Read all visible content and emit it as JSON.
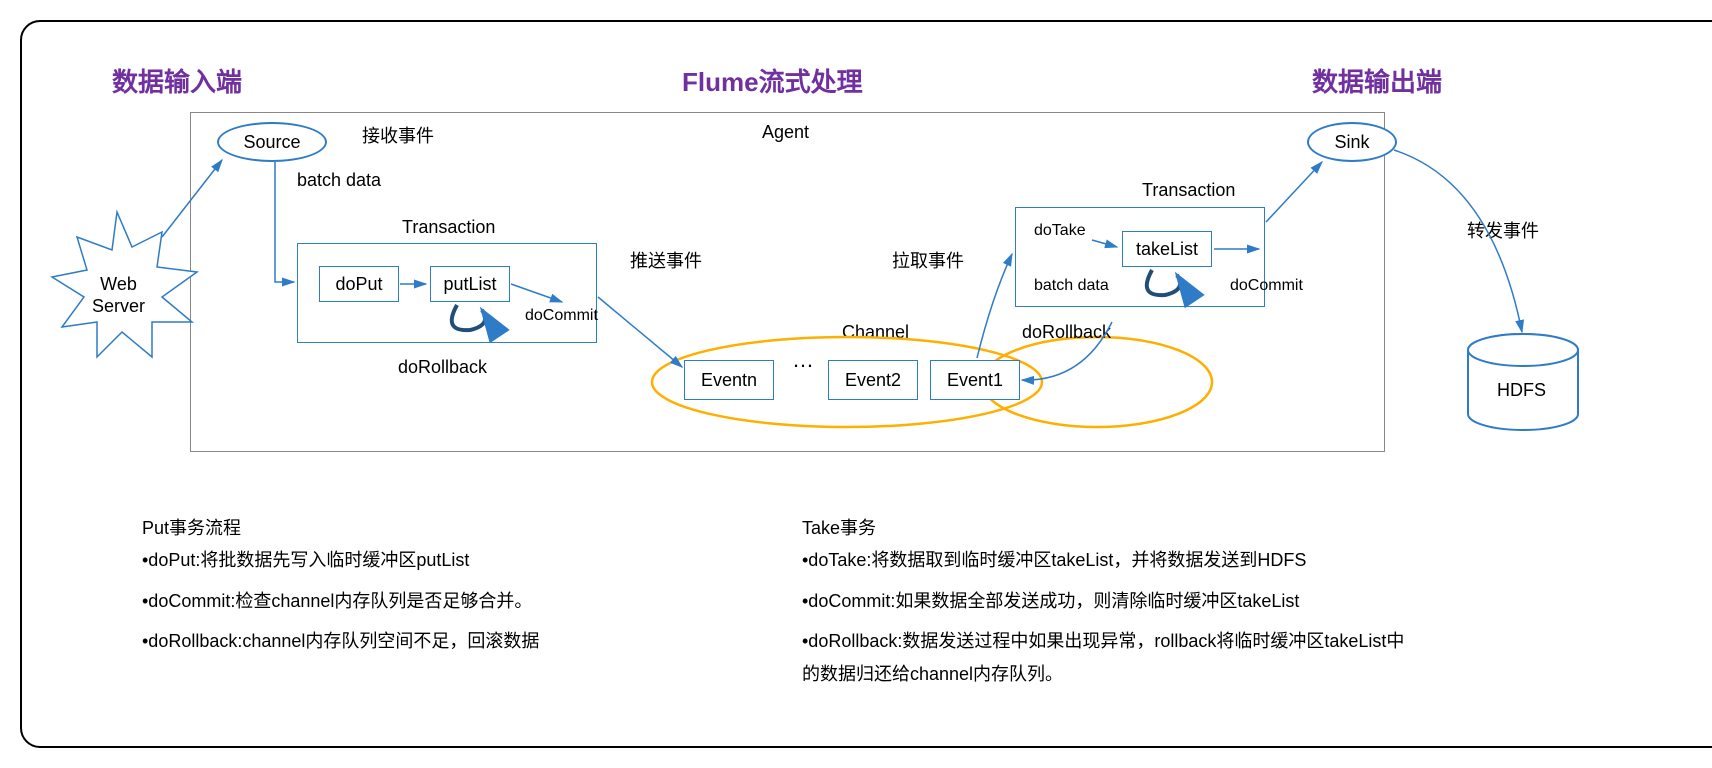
{
  "titles": {
    "input": "数据输入端",
    "center": "Flume流式处理",
    "output": "数据输出端"
  },
  "nodes": {
    "webserver": "Web\nServer",
    "source": "Source",
    "recvEvent": "接收事件",
    "batchData1": "batch data",
    "agent": "Agent",
    "transaction1": "Transaction",
    "doPut": "doPut",
    "putList": "putList",
    "doCommit1": "doCommit",
    "doRollback1": "doRollback",
    "pushEvent": "推送事件",
    "pullEvent": "拉取事件",
    "channel": "Channel",
    "eventn": "Eventn",
    "dots": "…",
    "event2": "Event2",
    "event1": "Event1",
    "transaction2": "Transaction",
    "doTake": "doTake",
    "takeList": "takeList",
    "batchData2": "batch data",
    "doCommit2": "doCommit",
    "doRollback2": "doRollback",
    "sink": "Sink",
    "forwardEvent": "转发事件",
    "hdfs": "HDFS"
  },
  "descriptions": {
    "put": {
      "title": "Put事务流程",
      "line1": "•doPut:将批数据先写入临时缓冲区putList",
      "line2": "•doCommit:检查channel内存队列是否足够合并。",
      "line3": "•doRollback:channel内存队列空间不足，回滚数据"
    },
    "take": {
      "title": "Take事务",
      "line1": "•doTake:将数据取到临时缓冲区takeList，并将数据发送到HDFS",
      "line2": "•doCommit:如果数据全部发送成功，则清除临时缓冲区takeList",
      "line3": "•doRollback:数据发送过程中如果出现异常，rollback将临时缓冲区takeList中的数据归还给channel内存队列。"
    }
  }
}
